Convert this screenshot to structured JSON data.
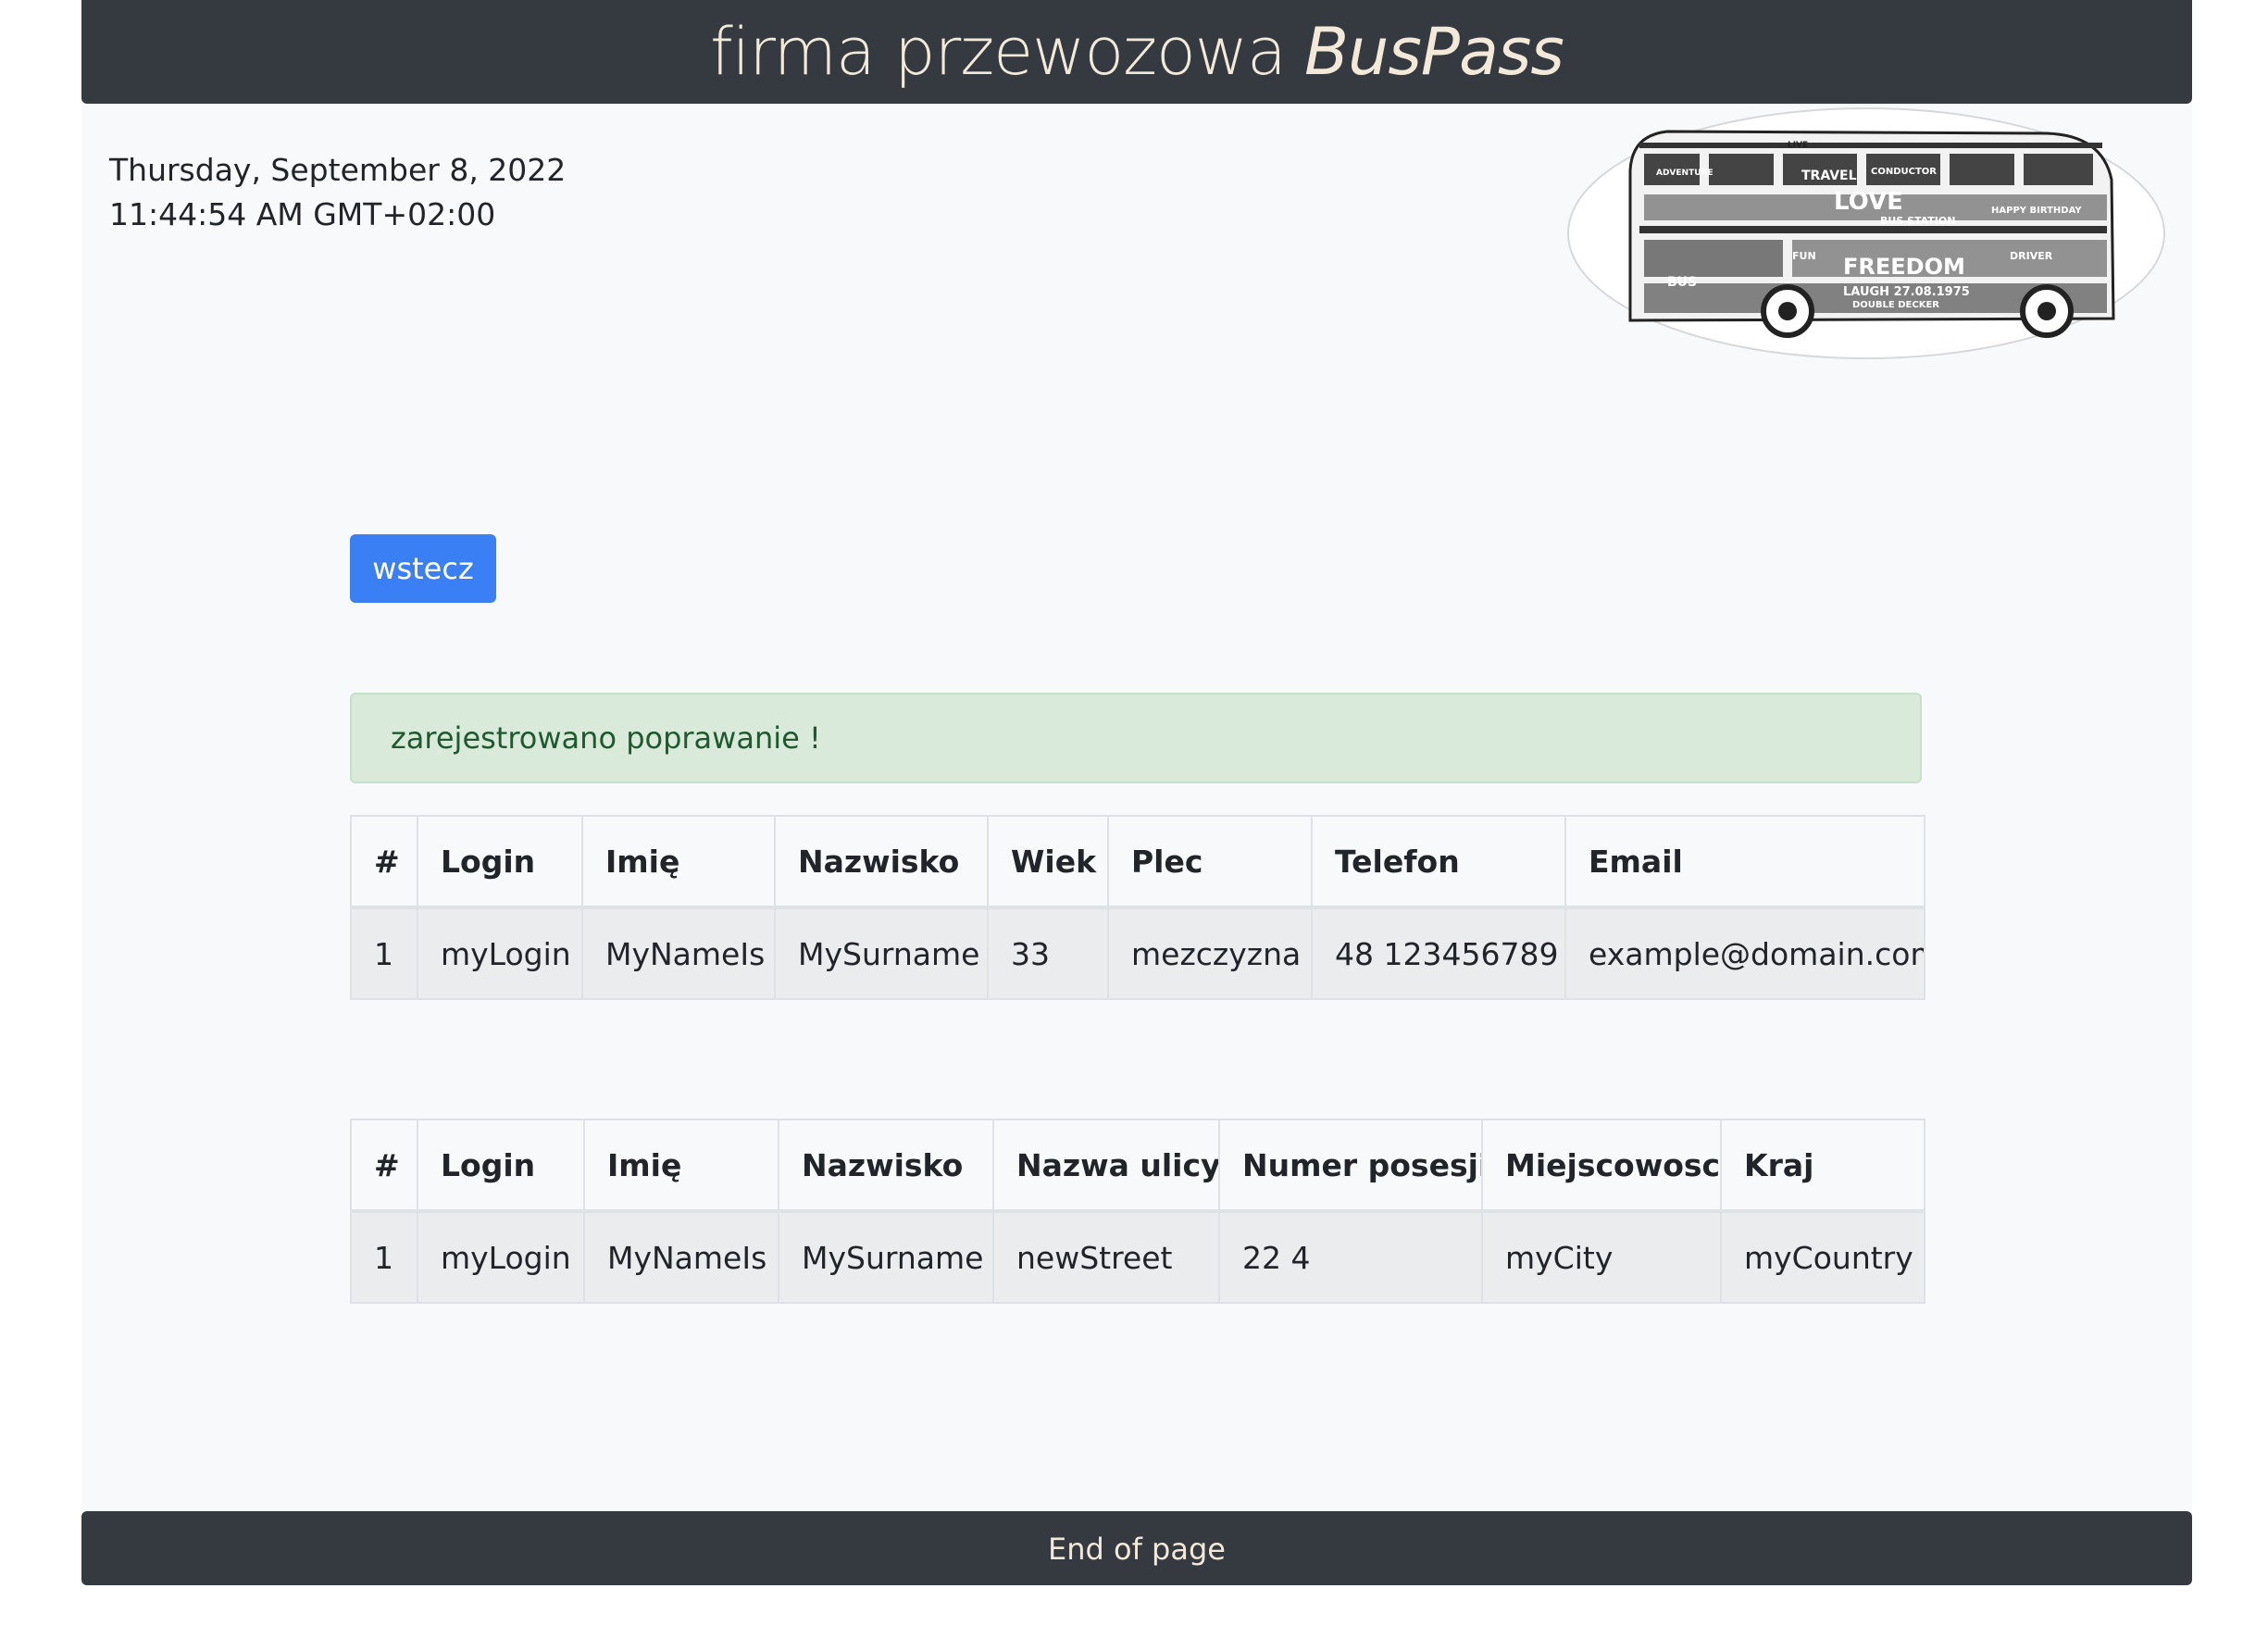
{
  "header": {
    "title_prefix": "firma przewozowa",
    "brand": "BusPass"
  },
  "datetime": {
    "date": "Thursday, September 8, 2022",
    "time": "11:44:54 AM GMT+02:00"
  },
  "logo": {
    "icon": "bus-word-cloud-logo",
    "words": [
      "ADVENTURE",
      "LIVE",
      "CONDUCTOR",
      "TRAVEL",
      "LOVE",
      "BUS STATION",
      "HAPPY BIRTHDAY",
      "FREEDOM",
      "LAUGH 27.08.1975",
      "DOUBLE DECKER",
      "DRIVER",
      "FUN",
      "BUS"
    ]
  },
  "back_button": {
    "label": "wstecz"
  },
  "alert": {
    "message": "zarejestrowano poprawanie !"
  },
  "users_table": {
    "headers": [
      "#",
      "Login",
      "Imię",
      "Nazwisko",
      "Wiek",
      "Plec",
      "Telefon",
      "Email"
    ],
    "rows": [
      [
        "1",
        "myLogin",
        "MyNameIs",
        "MySurname",
        "33",
        "mezczyzna",
        "48 123456789",
        "example@domain.com"
      ]
    ]
  },
  "address_table": {
    "headers": [
      "#",
      "Login",
      "Imię",
      "Nazwisko",
      "Nazwa ulicy",
      "Numer posesji",
      "Miejscowosc",
      "Kraj"
    ],
    "rows": [
      [
        "1",
        "myLogin",
        "MyNameIs",
        "MySurname",
        "newStreet",
        "22 4",
        "myCity",
        "myCountry"
      ]
    ]
  },
  "footer": {
    "text": "End of page"
  },
  "colors": {
    "header_bg": "#343a40",
    "header_text": "#f3e9d8",
    "button_bg": "#3b7ff5",
    "alert_bg": "#d9eadb",
    "alert_text": "#1f5a2e"
  }
}
